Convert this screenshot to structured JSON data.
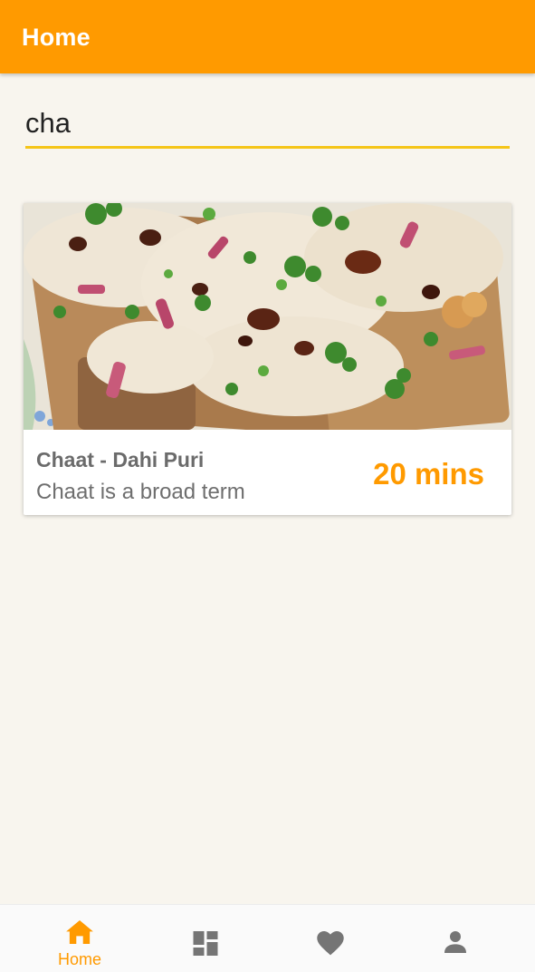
{
  "colors": {
    "accent": "#ff9a00",
    "search_underline": "#f5c518",
    "inactive_icon": "#757575",
    "background": "#f8f5ee"
  },
  "appbar": {
    "title": "Home"
  },
  "search": {
    "value": "cha"
  },
  "results": [
    {
      "title": "Chaat - Dahi Puri",
      "description": "Chaat is a broad term",
      "time": "20 mins",
      "image_icon": "food-photo"
    }
  ],
  "bottom_nav": {
    "active_index": 0,
    "items": [
      {
        "icon": "home-icon",
        "label": "Home"
      },
      {
        "icon": "dashboard-icon",
        "label": ""
      },
      {
        "icon": "heart-icon",
        "label": ""
      },
      {
        "icon": "person-icon",
        "label": ""
      }
    ]
  }
}
